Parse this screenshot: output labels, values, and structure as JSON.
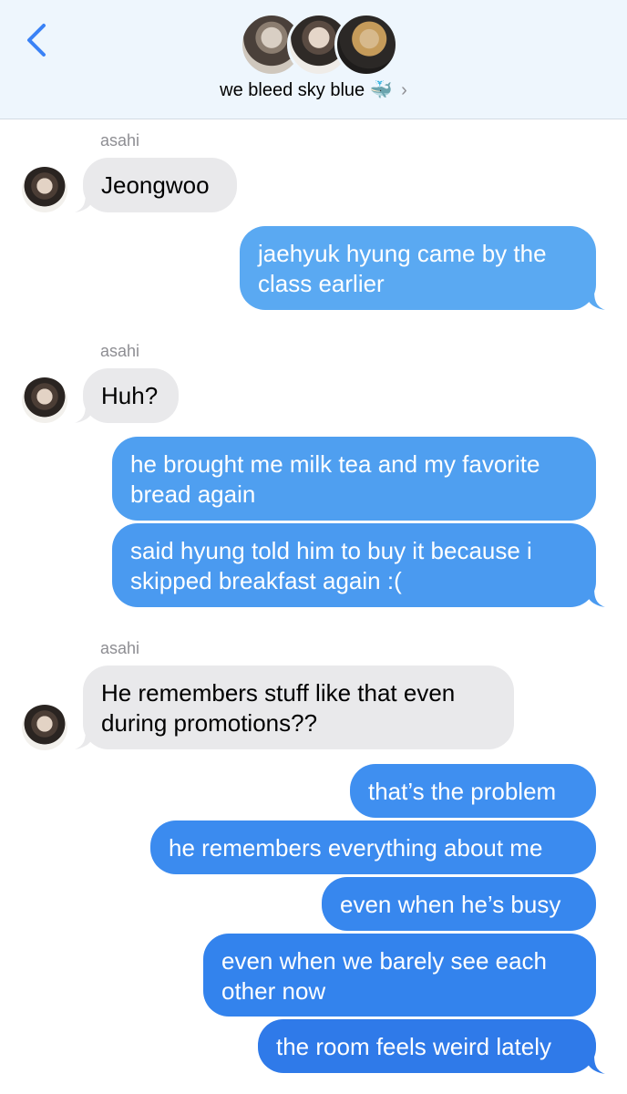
{
  "header": {
    "group_name": "we bleed sky blue",
    "group_emoji": "🐳"
  },
  "messages": [
    {
      "sender": "asahi",
      "text": "Jeongwoo"
    },
    {
      "text": "jaehyuk hyung came by the",
      "text2": "class earlier"
    },
    {
      "sender": "asahi",
      "text": "Huh?"
    },
    {
      "text": "he brought me milk tea and my favorite",
      "text2": "bread again"
    },
    {
      "text": "said hyung told him to buy it because i",
      "text2": "skipped breakfast again :("
    },
    {
      "sender": "asahi",
      "text": "He remembers stuff like that even",
      "text2": "during promotions??"
    },
    {
      "text": "that’s the problem"
    },
    {
      "text": "he remembers everything about me"
    },
    {
      "text": "even when he’s busy"
    },
    {
      "text": "even when we barely see each",
      "text2": "other now"
    },
    {
      "text": "the room feels weird lately"
    }
  ],
  "colors": {
    "header_bg": "#eef6fd",
    "incoming_bubble": "#e9e9eb",
    "outgoing_top": "#5aa9f2",
    "outgoing_bottom": "#2f7ae9",
    "back_arrow": "#3a82f6"
  }
}
